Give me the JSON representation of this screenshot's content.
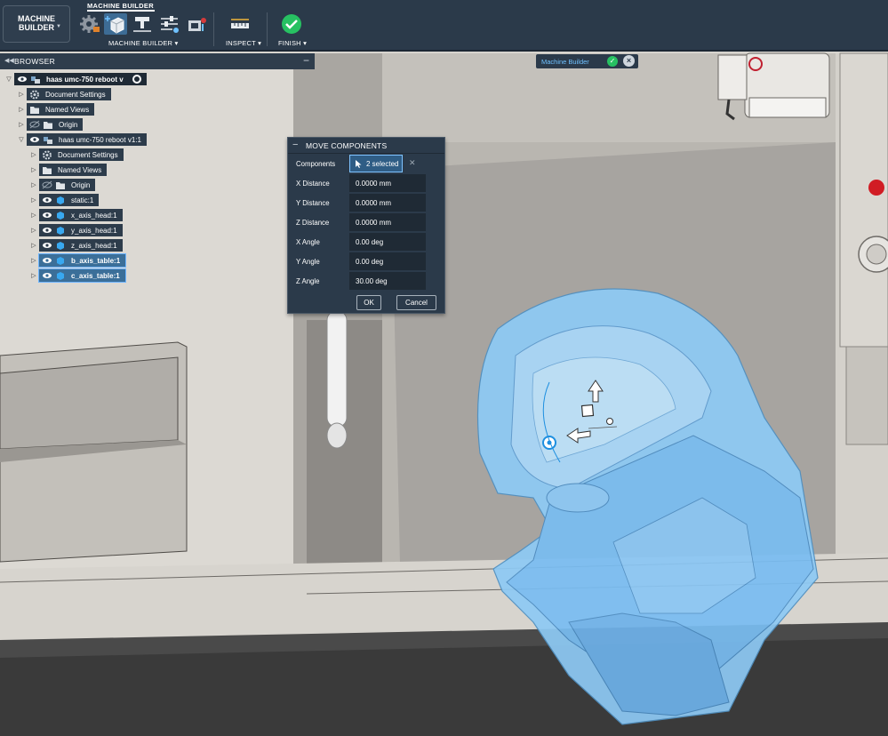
{
  "toolbar": {
    "workspace_label_line1": "MACHINE",
    "workspace_label_line2": "BUILDER",
    "group_title": "MACHINE BUILDER",
    "machine_builder_menu": "MACHINE BUILDER",
    "inspect_menu": "INSPECT",
    "finish_menu": "FINISH",
    "icons": [
      "settings-icon",
      "move-icon",
      "align-icon",
      "joint-sliders-icon",
      "machine-icon",
      "measure-ruler-icon",
      "finish-check-icon"
    ],
    "accent_color": "#3d6c95",
    "finish_color": "#27c162"
  },
  "browser": {
    "title": "BROWSER",
    "root": "haas umc-750 reboot v",
    "items": [
      {
        "label": "Document Settings",
        "icon": "gear-icon"
      },
      {
        "label": "Named Views",
        "icon": "folder-icon"
      },
      {
        "label": "Origin",
        "icon": "folder-icon"
      },
      {
        "label": "haas umc-750 reboot v1:1",
        "icon": "component-icon"
      },
      {
        "label": "Document Settings",
        "icon": "gear-icon"
      },
      {
        "label": "Named Views",
        "icon": "folder-icon"
      },
      {
        "label": "Origin",
        "icon": "folder-icon"
      },
      {
        "label": "static:1",
        "icon": "body-icon"
      },
      {
        "label": "x_axis_head:1",
        "icon": "body-icon"
      },
      {
        "label": "y_axis_head:1",
        "icon": "body-icon"
      },
      {
        "label": "z_axis_head:1",
        "icon": "body-icon"
      },
      {
        "label": "b_axis_table:1",
        "icon": "body-icon",
        "selected": true
      },
      {
        "label": "c_axis_table:1",
        "icon": "body-icon",
        "selected": true
      }
    ]
  },
  "workspace_badge": {
    "label": "Machine Builder"
  },
  "dialog": {
    "title": "MOVE COMPONENTS",
    "components_label": "Components",
    "components_value": "2 selected",
    "rows": [
      {
        "label": "X Distance",
        "value": "0.0000 mm"
      },
      {
        "label": "Y Distance",
        "value": "0.0000 mm"
      },
      {
        "label": "Z Distance",
        "value": "0.0000 mm"
      },
      {
        "label": "X Angle",
        "value": "0.00 deg"
      },
      {
        "label": "Y Angle",
        "value": "0.00 deg"
      },
      {
        "label": "Z Angle",
        "value": "30.00 deg"
      }
    ],
    "ok_label": "OK",
    "cancel_label": "Cancel"
  },
  "colors": {
    "selection_blue": "#6fb6ff",
    "panel_bg": "#2b3a4a"
  }
}
